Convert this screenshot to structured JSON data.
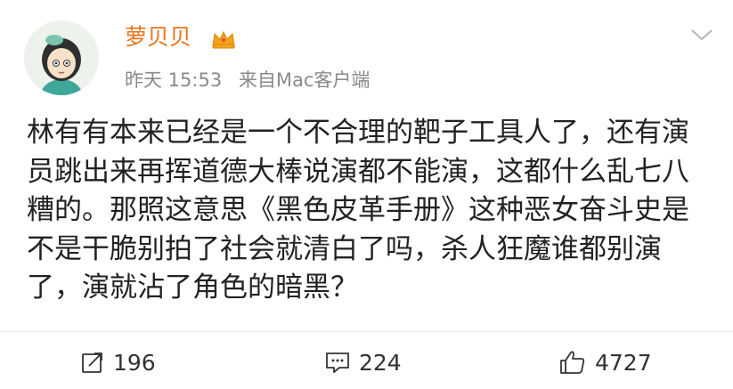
{
  "post": {
    "username": "萝贝贝",
    "time": "昨天 15:53",
    "source": "来自Mac客户端",
    "text": "林有有本来已经是一个不合理的靶子工具人了，还有演员跳出来再挥道德大棒说演都不能演，这都什么乱七八糟的。那照这意思《黑色皮革手册》这种恶女奋斗史是不是干脆别拍了社会就清白了吗，杀人狂魔谁都别演了，演就沾了角色的暗黑？"
  },
  "actions": {
    "repost_count": "196",
    "comment_count": "224",
    "like_count": "4727"
  },
  "colors": {
    "username": "#e8741c",
    "meta": "#8a8a8a",
    "text": "#222222",
    "crown": "#f2a31c"
  },
  "icons": {
    "avatar": "avatar-illustration",
    "crown": "crown-icon",
    "menu": "chevron-down-icon",
    "repost": "repost-icon",
    "comment": "comment-icon",
    "like": "thumbs-up-icon"
  }
}
